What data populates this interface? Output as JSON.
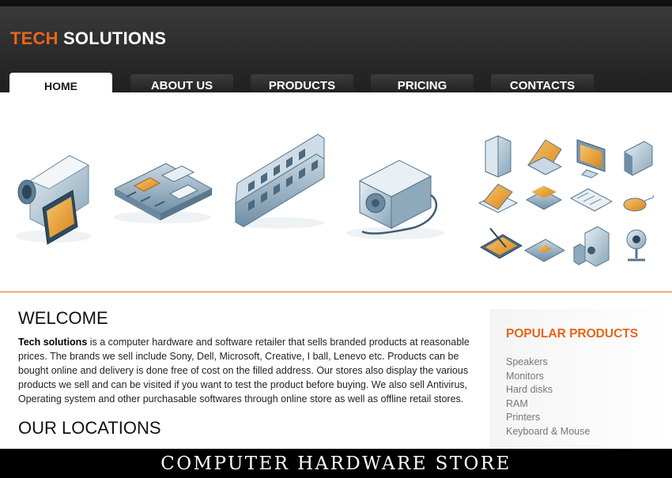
{
  "brand": {
    "part1": "TECH",
    "part2": "SOLUTIONS",
    "accent": "#e8651a"
  },
  "nav": {
    "home": "HOME",
    "about": "ABOUT US",
    "products": "PRODUCTS",
    "pricing": "PRICING",
    "contacts": "CONTACTS"
  },
  "banner": {
    "icons": [
      "camcorder-icon",
      "motherboard-icon",
      "ram-module-icon",
      "power-supply-icon",
      "desktop-tower-icon",
      "laptop-icon",
      "monitor-icon",
      "hard-disk-icon",
      "scanner-icon",
      "printer-icon",
      "keyboard-icon",
      "mouse-icon",
      "tablet-icon",
      "network-card-icon",
      "speakers-icon",
      "webcam-icon"
    ]
  },
  "welcome": {
    "title": "WELCOME",
    "strong": "Tech solutions",
    "text": " is a computer hardware and software retailer that sells branded products at reasonable prices. The brands we sell include Sony, Dell, Microsoft, Creative, I ball, Lenevo etc. Products can be bought online and delivery is done free of cost on the filled address. Our stores also display the various products we sell and can be visited if you want to test the product before buying. We also sell Antivirus, Operating system and other purchasable softwares through online store as well as offline retail stores."
  },
  "locations": {
    "title": "OUR LOCATIONS"
  },
  "popular": {
    "title": "POPULAR PRODUCTS",
    "items": [
      "Speakers",
      "Monitors",
      "Hard disks",
      "RAM",
      "Printers",
      "Keyboard & Mouse"
    ]
  },
  "footer": {
    "caption": "COMPUTER HARDWARE STORE"
  }
}
